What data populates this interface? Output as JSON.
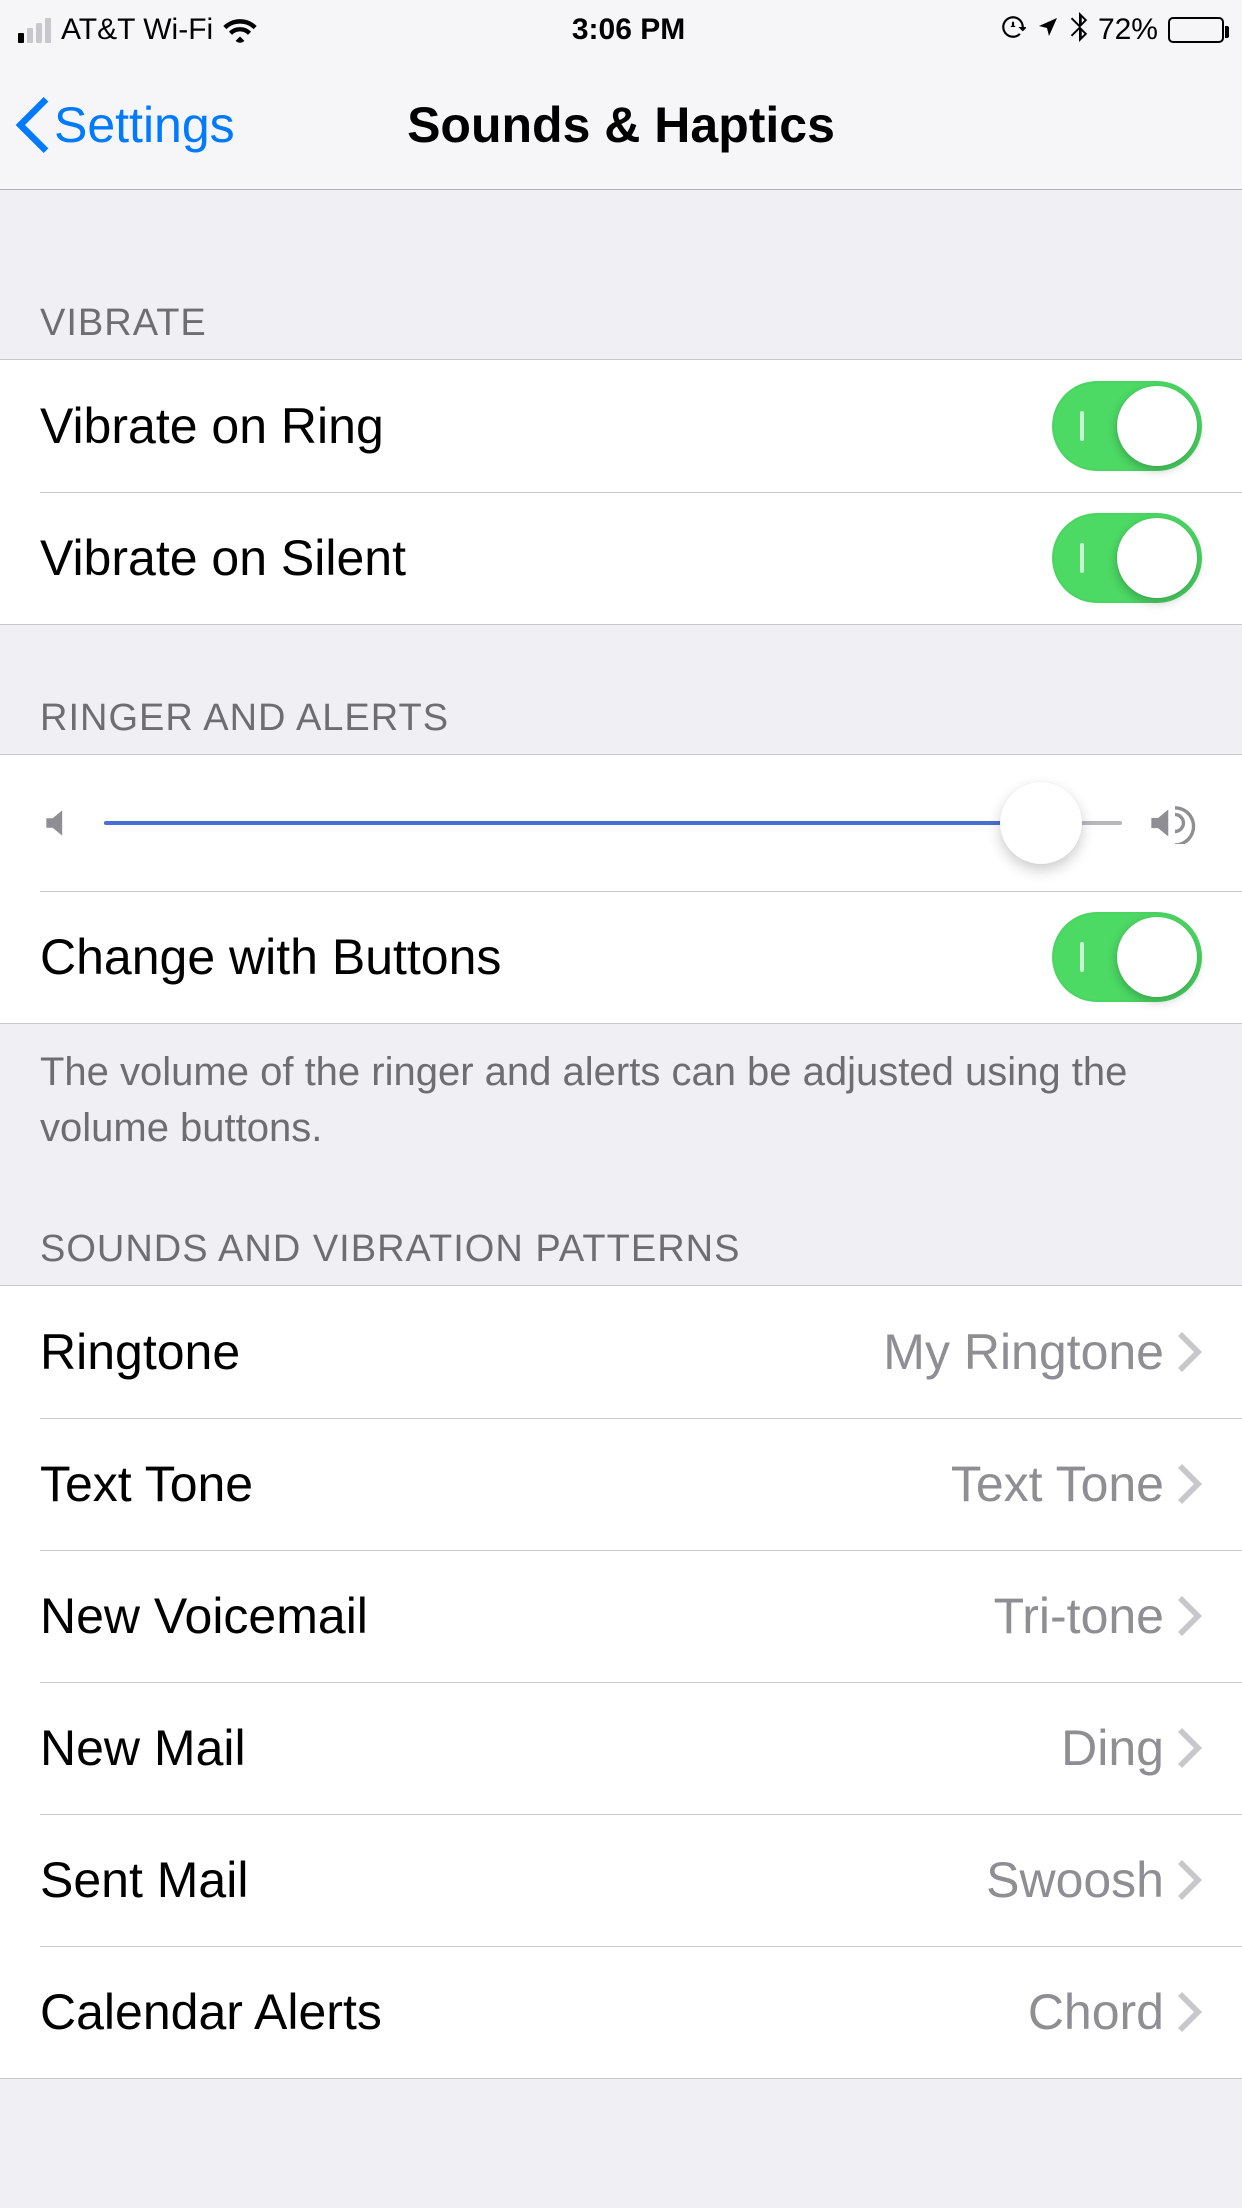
{
  "status": {
    "carrier": "AT&T Wi-Fi",
    "time": "3:06 PM",
    "battery_percent": "72%"
  },
  "nav": {
    "back_label": "Settings",
    "title": "Sounds & Haptics"
  },
  "sections": {
    "vibrate": {
      "header": "Vibrate",
      "items": [
        {
          "label": "Vibrate on Ring",
          "on": true
        },
        {
          "label": "Vibrate on Silent",
          "on": true
        }
      ]
    },
    "ringer": {
      "header": "Ringer and Alerts",
      "volume_percent": 92,
      "change_with_buttons": {
        "label": "Change with Buttons",
        "on": true
      },
      "footer": "The volume of the ringer and alerts can be adjusted using the volume buttons."
    },
    "sounds": {
      "header": "Sounds and Vibration Patterns",
      "items": [
        {
          "label": "Ringtone",
          "value": "My Ringtone"
        },
        {
          "label": "Text Tone",
          "value": "Text Tone"
        },
        {
          "label": "New Voicemail",
          "value": "Tri-tone"
        },
        {
          "label": "New Mail",
          "value": "Ding"
        },
        {
          "label": "Sent Mail",
          "value": "Swoosh"
        },
        {
          "label": "Calendar Alerts",
          "value": "Chord"
        }
      ]
    }
  }
}
